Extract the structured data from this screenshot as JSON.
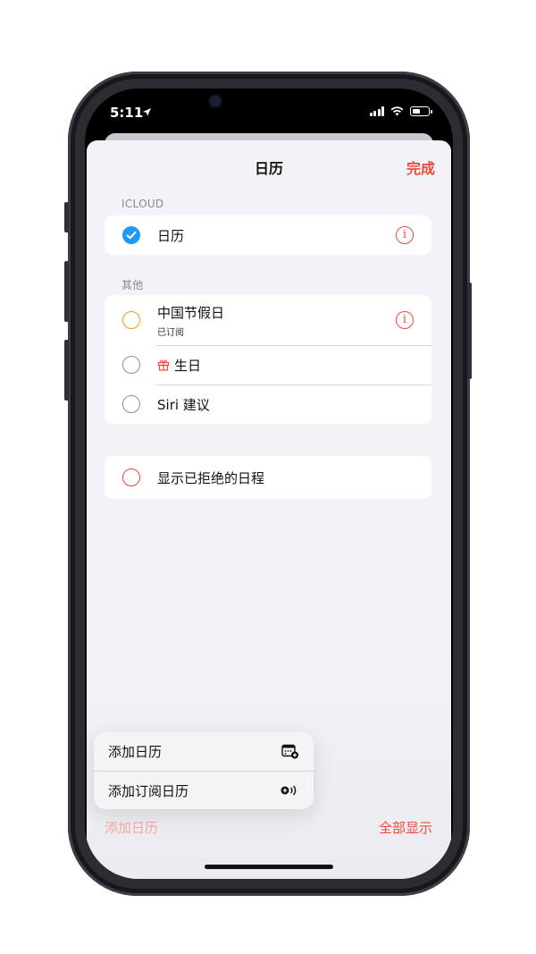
{
  "status_bar": {
    "time": "5:11"
  },
  "sheet": {
    "title": "日历",
    "done_label": "完成",
    "colors": {
      "accent": "#f0493a",
      "checked_blue": "#1e9bf0",
      "orange": "#f39c12",
      "gray": "#8e8ea0"
    },
    "icloud_section": {
      "header": "ICLOUD",
      "items": [
        {
          "label": "日历",
          "checked": true,
          "has_info": true
        }
      ]
    },
    "other_section": {
      "header": "其他",
      "items": [
        {
          "label": "中国节假日",
          "subtitle": "已订阅",
          "checked": false,
          "has_info": true,
          "circle_color": "orange"
        },
        {
          "label": "生日",
          "icon": "gift-icon",
          "checked": false,
          "circle_color": "gray"
        },
        {
          "label": "Siri 建议",
          "checked": false,
          "circle_color": "gray"
        }
      ]
    },
    "declined_row": {
      "label": "显示已拒绝的日程",
      "checked": false,
      "circle_color": "red"
    },
    "menu": {
      "items": [
        {
          "label": "添加日历",
          "icon": "calendar-add-icon"
        },
        {
          "label": "添加订阅日历",
          "icon": "subscribe-broadcast-icon"
        }
      ]
    },
    "footer": {
      "add_calendar": "添加日历",
      "show_all": "全部显示"
    }
  }
}
